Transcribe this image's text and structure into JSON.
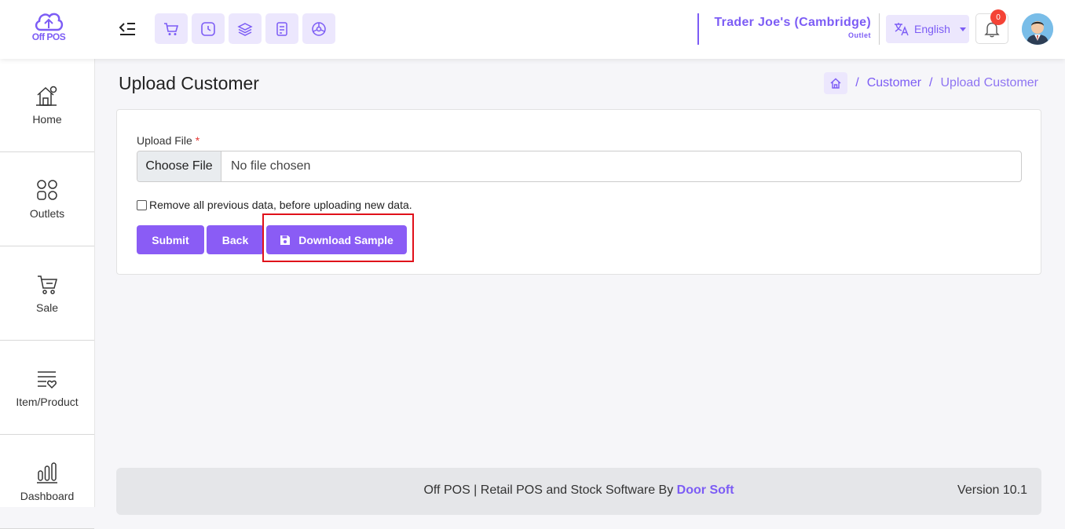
{
  "app": {
    "logo_text": "Off POS"
  },
  "header": {
    "quick_actions": [
      "cart-icon",
      "clock-icon",
      "layers-icon",
      "receipt-icon",
      "dashboard-icon"
    ],
    "outlet_name": "Trader Joe's (Cambridge)",
    "outlet_sub": "Outlet",
    "language": "English",
    "notification_count": "0"
  },
  "sidebar": {
    "items": [
      {
        "label": "Home",
        "icon": "home-icon"
      },
      {
        "label": "Outlets",
        "icon": "outlets-icon"
      },
      {
        "label": "Sale",
        "icon": "cart-icon"
      },
      {
        "label": "Item/Product",
        "icon": "item-list-icon"
      },
      {
        "label": "Dashboard",
        "icon": "bar-chart-icon"
      }
    ]
  },
  "page": {
    "title": "Upload Customer",
    "breadcrumb": [
      "Customer",
      "Upload Customer"
    ]
  },
  "form": {
    "upload_label": "Upload File",
    "required_mark": "*",
    "choose_file": "Choose File",
    "no_file": "No file chosen",
    "checkbox_label": "Remove all previous data, before uploading new data.",
    "submit": "Submit",
    "back": "Back",
    "download": "Download Sample"
  },
  "footer": {
    "text_prefix": "Off POS | Retail POS and Stock Software By ",
    "brand": "Door Soft",
    "version": "Version 10.1"
  },
  "colors": {
    "accent": "#7c5cf5",
    "button": "#8a5cf5",
    "highlight": "#e0101a"
  }
}
